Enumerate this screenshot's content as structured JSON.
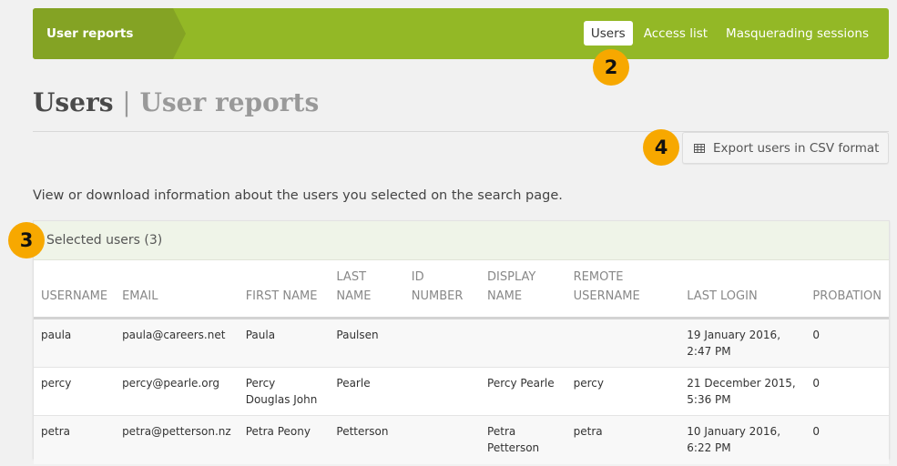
{
  "navbar": {
    "breadcrumb": "User reports",
    "links": [
      {
        "label": "Users",
        "active": true
      },
      {
        "label": "Access list",
        "active": false
      },
      {
        "label": "Masquerading sessions",
        "active": false
      }
    ]
  },
  "callouts": [
    "2",
    "3",
    "4"
  ],
  "page": {
    "title": "Users",
    "separator": "|",
    "subtitle": "User reports"
  },
  "toolbar": {
    "export_icon": "table-icon",
    "export_label": "Export users in CSV format"
  },
  "intro": "View or download information about the users you selected on the search page.",
  "panel": {
    "title": "Selected users (3)",
    "columns": [
      {
        "line1": "",
        "line2": "USERNAME"
      },
      {
        "line1": "",
        "line2": "EMAIL"
      },
      {
        "line1": "",
        "line2": "FIRST NAME"
      },
      {
        "line1": "LAST",
        "line2": "NAME"
      },
      {
        "line1": "ID",
        "line2": "NUMBER"
      },
      {
        "line1": "DISPLAY",
        "line2": "NAME"
      },
      {
        "line1": "REMOTE",
        "line2": "USERNAME"
      },
      {
        "line1": "",
        "line2": "LAST LOGIN"
      },
      {
        "line1": "",
        "line2": "PROBATION"
      }
    ],
    "rows": [
      [
        "paula",
        "paula@careers.net",
        "Paula",
        "Paulsen",
        "",
        "",
        "",
        "19 January 2016, 2:47 PM",
        "0"
      ],
      [
        "percy",
        "percy@pearle.org",
        "Percy Douglas John",
        "Pearle",
        "",
        "Percy Pearle",
        "percy",
        "21 December 2015, 5:36 PM",
        "0"
      ],
      [
        "petra",
        "petra@petterson.nz",
        "Petra Peony",
        "Petterson",
        "",
        "Petra Petterson",
        "petra",
        "10 January 2016, 6:22 PM",
        "0"
      ]
    ]
  },
  "colors": {
    "navbar": "#93b826",
    "breadcrumb": "#84a324",
    "callout": "#f7a800",
    "panel_header": "#eff4e8"
  }
}
